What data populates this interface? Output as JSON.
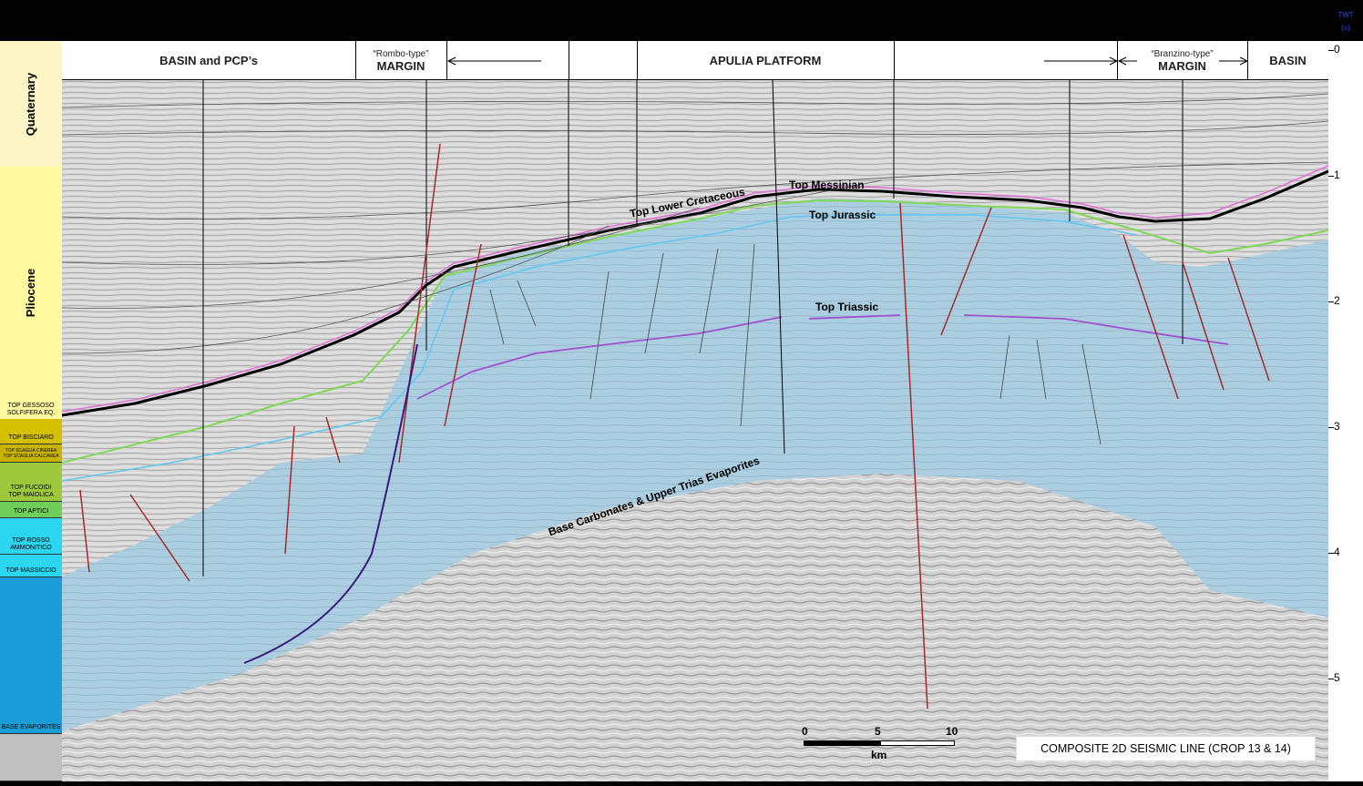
{
  "axis": {
    "unit_title": "TWT",
    "unit": "(s)",
    "ticks": [
      "0",
      "1",
      "2",
      "3",
      "4",
      "5"
    ]
  },
  "header": {
    "basin_pcp": "BASIN and PCP’s",
    "rombo_sub": "“Rombo-type”",
    "rombo_main": "MARGIN",
    "apulia": "APULIA PLATFORM",
    "branzino_sub": "“Branzino-type”",
    "branzino_main": "MARGIN",
    "basin": "BASIN"
  },
  "column": {
    "periods": [
      "Quaternary",
      "Pliocene"
    ],
    "tops": [
      "TOP GESSOSO SOLFIFERA EQ.",
      "TOP BISCIARO",
      "TOP SCAGLIA CINEREA",
      "TOP SCAGLIA CALCAREA",
      "TOP FUCOIDI",
      "TOP MAIOLICA",
      "TOP APTICI",
      "TOP ROSSO AMMONITICO",
      "TOP MASSICCIO",
      "BASE EVAPORITES"
    ]
  },
  "horizons": {
    "messinian": "Top Messinian",
    "lower_cretaceous": "Top Lower Cretaceous",
    "jurassic": "Top Jurassic",
    "triassic": "Top Triassic",
    "base_carbonates": "Base Carbonates & Upper Trias Evaporites"
  },
  "scale_bar": {
    "labels": [
      "0",
      "5",
      "10"
    ],
    "unit": "km"
  },
  "caption": "COMPOSITE 2D SEISMIC LINE (CROP 13 & 14)",
  "colors": {
    "carbonate": "#a9cde0",
    "seismic_bg": "#d6d6d6",
    "fault": "#a52a2a",
    "messinian": "#e070d8",
    "cretaceous": "#7ed957",
    "jurassic": "#5fc8f0",
    "triassic": "#a050d0",
    "quaternary": "#fff6c8",
    "pliocene": "#fff9a0",
    "miocene": "#c8b400",
    "cretaceous_col": "#9dc83c",
    "aptici": "#6fce5a",
    "jurassic_col": "#2bd6f0",
    "massiccio": "#1a9dd6",
    "evaporites": "#c0c0c0"
  }
}
